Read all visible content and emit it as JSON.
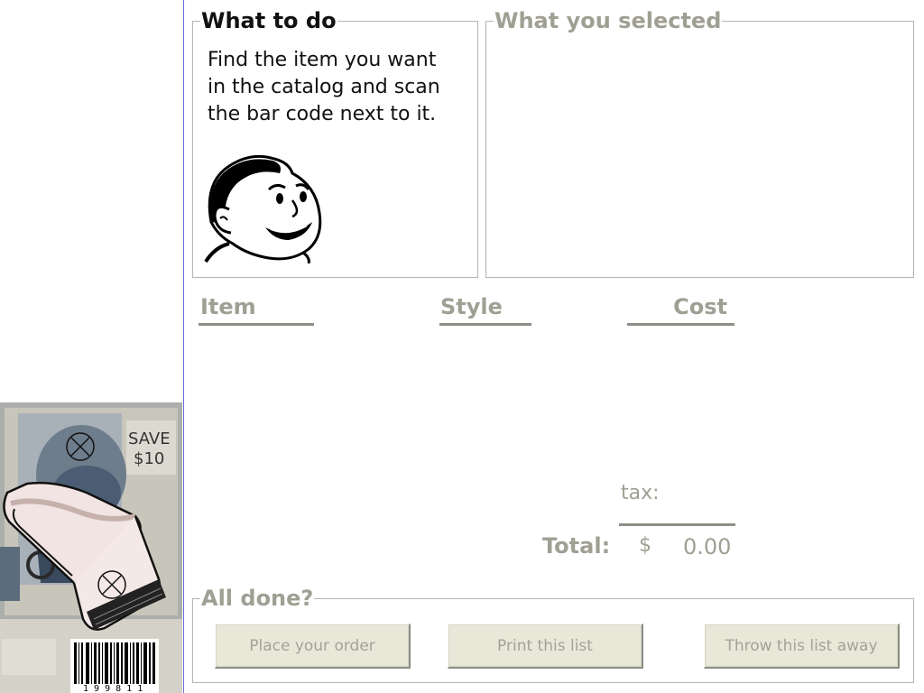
{
  "instructions": {
    "title": "What to do",
    "text": "Find the item you want\nin the catalog and scan\nthe bar code next to it."
  },
  "selection": {
    "title": "What you selected"
  },
  "columns": {
    "item": "Item",
    "style": "Style",
    "cost": "Cost"
  },
  "totals": {
    "tax_label": "tax:",
    "total_label": "Total:",
    "currency": "$",
    "total_value": "0.00"
  },
  "done": {
    "title": "All done?",
    "place_order": "Place your order",
    "print_list": "Print this list",
    "throw_away": "Throw this list away"
  },
  "scanner": {
    "catalog_badge_line1": "SAVE",
    "catalog_badge_line2": "$10",
    "barcode_number": "1 9 9 8 1 1"
  },
  "colors": {
    "accent_gray": "#a09f93",
    "button_face": "#e9e8d8",
    "divider_blue": "#6b6bd6"
  }
}
